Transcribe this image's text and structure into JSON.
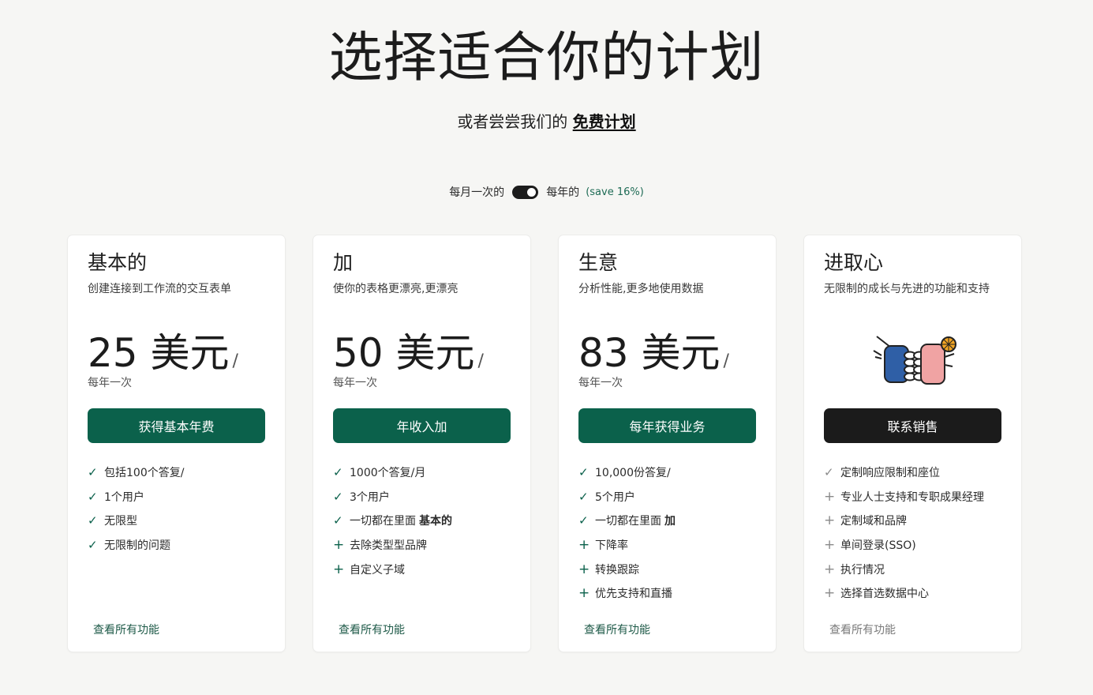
{
  "hero": {
    "title": "选择适合你的计划",
    "subtitle_prefix": "或者尝尝我们的",
    "subtitle_link": "免费计划"
  },
  "billing": {
    "monthly_label": "每月一次的",
    "yearly_label": "每年的",
    "save_label": "(save 16%)",
    "selected": "yearly"
  },
  "plans": [
    {
      "name": "基本的",
      "desc": "创建连接到工作流的交互表单",
      "price": "25 美元",
      "price_suffix": "/",
      "period": "每年一次",
      "cta": "获得基本年费",
      "features": [
        {
          "icon": "check",
          "text": "包括100个答复/",
          "bold": ""
        },
        {
          "icon": "check",
          "text": "1个用户",
          "bold": ""
        },
        {
          "icon": "check",
          "text": "无限型",
          "bold": ""
        },
        {
          "icon": "check",
          "text": "无限制的问题",
          "bold": ""
        }
      ],
      "see_all": "查看所有功能"
    },
    {
      "name": "加",
      "desc": "使你的表格更漂亮,更漂亮",
      "price": "50 美元",
      "price_suffix": "/",
      "period": "每年一次",
      "cta": "年收入加",
      "features": [
        {
          "icon": "check",
          "text": "1000个答复/月",
          "bold": ""
        },
        {
          "icon": "check",
          "text": "3个用户",
          "bold": ""
        },
        {
          "icon": "check",
          "text": "一切都在里面",
          "bold": "基本的"
        },
        {
          "icon": "plus",
          "text": "去除类型型品牌",
          "bold": ""
        },
        {
          "icon": "plus",
          "text": "自定义子域",
          "bold": ""
        }
      ],
      "see_all": "查看所有功能"
    },
    {
      "name": "生意",
      "desc": "分析性能,更多地使用数据",
      "price": "83 美元",
      "price_suffix": "/",
      "period": "每年一次",
      "cta": "每年获得业务",
      "features": [
        {
          "icon": "check",
          "text": "10,000份答复/",
          "bold": ""
        },
        {
          "icon": "check",
          "text": "5个用户",
          "bold": ""
        },
        {
          "icon": "check",
          "text": "一切都在里面",
          "bold": "加"
        },
        {
          "icon": "plus",
          "text": "下降率",
          "bold": ""
        },
        {
          "icon": "plus",
          "text": "转换跟踪",
          "bold": ""
        },
        {
          "icon": "plus",
          "text": "优先支持和直播",
          "bold": ""
        }
      ],
      "see_all": "查看所有功能"
    },
    {
      "name": "进取心",
      "desc": "无限制的成长与先进的功能和支持",
      "cta": "联系销售",
      "features": [
        {
          "icon": "check-grey",
          "text": "定制响应限制和座位",
          "bold": ""
        },
        {
          "icon": "plus-grey",
          "text": "专业人士支持和专职成果经理",
          "bold": ""
        },
        {
          "icon": "plus-grey",
          "text": "定制域和品牌",
          "bold": ""
        },
        {
          "icon": "plus-grey",
          "text": "单间登录(SSO)",
          "bold": ""
        },
        {
          "icon": "plus-grey",
          "text": "执行情况",
          "bold": ""
        },
        {
          "icon": "plus-grey",
          "text": "选择首选数据中心",
          "bold": ""
        }
      ],
      "see_all": "查看所有功能"
    }
  ],
  "colors": {
    "accent": "#0b614b",
    "dark_button": "#1b1b1b",
    "background": "#f6f6f4"
  }
}
